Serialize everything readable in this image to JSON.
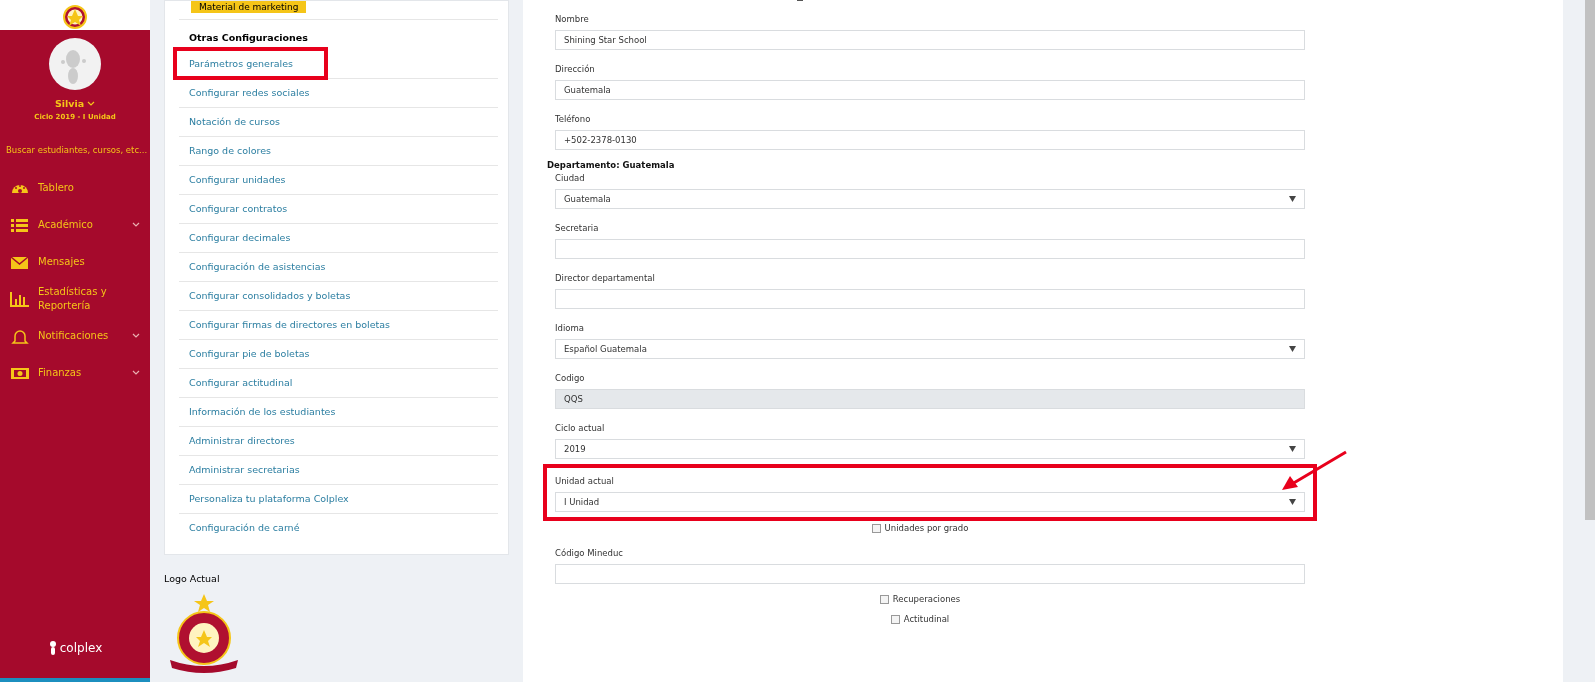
{
  "sidebar": {
    "user": {
      "name": "Silvia",
      "cycle": "Ciclo 2019 - I Unidad"
    },
    "search": {
      "placeholder": "Buscar estudiantes, cursos, etc..."
    },
    "items": [
      {
        "label": "Tablero",
        "expandable": false
      },
      {
        "label": "Académico",
        "expandable": true
      },
      {
        "label": "Mensajes",
        "expandable": false
      },
      {
        "label": "Estadísticas y Reportería",
        "expandable": false
      },
      {
        "label": "Notificaciones",
        "expandable": true
      },
      {
        "label": "Finanzas",
        "expandable": true
      }
    ],
    "brand": "colplex"
  },
  "settings_menu": {
    "top_button": "Material de marketing",
    "heading": "Otras Configuraciones",
    "items": [
      {
        "label": "Parámetros generales",
        "highlighted": true
      },
      {
        "label": "Configurar redes sociales",
        "highlighted": false
      },
      {
        "label": "Notación de cursos",
        "highlighted": false
      },
      {
        "label": "Rango de colores",
        "highlighted": false
      },
      {
        "label": "Configurar unidades",
        "highlighted": false
      },
      {
        "label": "Configurar contratos",
        "highlighted": false
      },
      {
        "label": "Configurar decimales",
        "highlighted": false
      },
      {
        "label": "Configuración de asistencias",
        "highlighted": false
      },
      {
        "label": "Configurar consolidados y boletas",
        "highlighted": false
      },
      {
        "label": "Configurar firmas de directores en boletas",
        "highlighted": false
      },
      {
        "label": "Configurar pie de boletas",
        "highlighted": false
      },
      {
        "label": "Configurar actitudinal",
        "highlighted": false
      },
      {
        "label": "Información de los estudiantes",
        "highlighted": false
      },
      {
        "label": "Administrar directores",
        "highlighted": false
      },
      {
        "label": "Administrar secretarias",
        "highlighted": false
      },
      {
        "label": "Personaliza tu plataforma Colplex",
        "highlighted": false
      },
      {
        "label": "Configuración de carné",
        "highlighted": false
      }
    ]
  },
  "logo_section": {
    "label": "Logo Actual"
  },
  "form": {
    "fields": [
      {
        "kind": "text",
        "label": "Nombre",
        "value": "Shining Star School",
        "highlighted": false
      },
      {
        "kind": "text",
        "label": "Dirección",
        "value": "Guatemala",
        "highlighted": false
      },
      {
        "kind": "text",
        "label": "Teléfono",
        "value": "+502-2378-0130",
        "highlighted": false
      },
      {
        "kind": "heading",
        "label": "Departamento: Guatemala"
      },
      {
        "kind": "select",
        "label": "Ciudad",
        "value": "Guatemala",
        "highlighted": false
      },
      {
        "kind": "text",
        "label": "Secretaria",
        "highlighted": false
      },
      {
        "kind": "text",
        "label": "Director departamental",
        "highlighted": false
      },
      {
        "kind": "select",
        "label": "Idioma",
        "value": "Español Guatemala",
        "highlighted": false
      },
      {
        "kind": "readonly",
        "label": "Codigo",
        "value": "QQS",
        "highlighted": false
      },
      {
        "kind": "select",
        "label": "Ciclo actual",
        "value": "2019",
        "highlighted": false
      },
      {
        "kind": "select",
        "label": "Unidad actual",
        "value": "I Unidad",
        "highlighted": true
      },
      {
        "kind": "checkbox",
        "label": "Unidades por grado",
        "checked": false
      },
      {
        "kind": "text",
        "label": "Código Mineduc",
        "highlighted": false
      },
      {
        "kind": "checkbox",
        "label": "Recuperaciones",
        "checked": false
      },
      {
        "kind": "checkbox",
        "label": "Actitudinal",
        "checked": false
      }
    ]
  }
}
